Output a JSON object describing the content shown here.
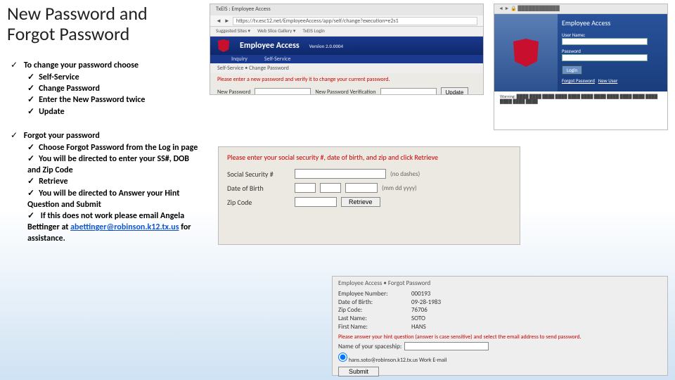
{
  "title": "New Password and Forgot Password",
  "section1": {
    "heading": "To change your password choose",
    "items": [
      "Self-Service",
      "Change Password",
      "Enter the New Password twice",
      "Update"
    ]
  },
  "section2": {
    "heading": "Forgot your password",
    "items": [
      "Choose Forgot Password from the Log in page",
      "You will be directed to enter your SS#, DOB and Zip Code",
      "Retrieve",
      "You will be directed to Answer your Hint Question and Submit"
    ],
    "last_pre": "If this does not work please email Angela Bettinger at ",
    "email": "abettinger@robinson.k12.tx.us",
    "last_post": " for assistance."
  },
  "shot_tl": {
    "url": "https://tv.esc12.net/EmployeeAccess/app/self/change?execution=e2s1",
    "bookmarks": [
      "Suggested Sites ▾",
      "Web Slice Gallery ▾",
      "TxEIS Login"
    ],
    "app_title": "Employee Access",
    "tab1": "Inquiry",
    "tab2": "Self-Service",
    "version": "Version 2.0.0004",
    "breadcrumb": "Self-Service • Change Password",
    "prompt": "Please enter a new password and verify it to change your current password.",
    "lbl_new": "New Password",
    "lbl_ver": "New Password Verification",
    "btn": "Update"
  },
  "shot_tr": {
    "title": "Employee Access",
    "lbl_user": "User Name:",
    "lbl_pass": "Password",
    "btn": "Login",
    "link1": "Forgot Password",
    "link2": "New User"
  },
  "shot_mid": {
    "prompt": "Please enter your social security #, date of birth, and zip and click Retrieve",
    "lbl_ssn": "Social Security #",
    "hint_ssn": "(no dashes)",
    "lbl_dob": "Date of Birth",
    "hint_dob": "(mm dd yyyy)",
    "lbl_zip": "Zip Code",
    "btn": "Retrieve"
  },
  "shot_br": {
    "breadcrumb": "Employee Access • Forgot Password",
    "rows": [
      [
        "Employee Number:",
        "000193"
      ],
      [
        "Date of Birth:",
        "09-28-1983"
      ],
      [
        "Zip Code:",
        "76706"
      ],
      [
        "Last Name:",
        "SOTO"
      ],
      [
        "First Name:",
        "HANS"
      ]
    ],
    "question_prompt": "Please answer your hint question (answer is case sensitive) and select the email address to send password.",
    "question": "Name of your spaceship:",
    "radio": "hans.soto@robinson.k12.tx.us   Work E-mail",
    "btn": "Submit"
  }
}
